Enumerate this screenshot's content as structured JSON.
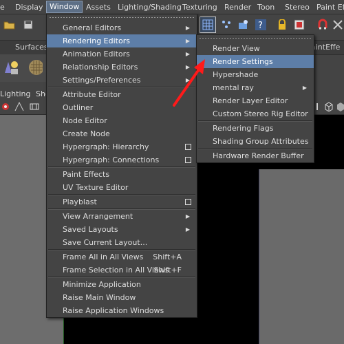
{
  "menubar": {
    "items": [
      "e",
      "Display",
      "Window",
      "Assets",
      "Lighting/Shading",
      "Texturing",
      "Render",
      "Toon",
      "Stereo",
      "Paint Eff"
    ],
    "active_index": 2
  },
  "shelf": {
    "tab_surfaces": "Surfaces",
    "tab_paint_effects": "aintEffe"
  },
  "panel_menu": {
    "lighting": "Lighting",
    "show": "Sho"
  },
  "toolbar_icons": [
    "open-folder-icon",
    "save-icon",
    "render-grid-icon",
    "render-region-icon",
    "ipr-icon",
    "help-icon",
    "lock-icon",
    "render-frame-icon",
    "magnet-icon",
    "snap-icon"
  ],
  "window_menu": {
    "items": [
      {
        "label": "General Editors",
        "type": "submenu"
      },
      {
        "label": "Rendering Editors",
        "type": "submenu",
        "highlighted": true
      },
      {
        "label": "Animation Editors",
        "type": "submenu"
      },
      {
        "label": "Relationship Editors",
        "type": "submenu"
      },
      {
        "label": "Settings/Preferences",
        "type": "submenu"
      },
      {
        "type": "separator"
      },
      {
        "label": "Attribute Editor"
      },
      {
        "label": "Outliner"
      },
      {
        "label": "Node Editor"
      },
      {
        "label": "Create Node"
      },
      {
        "label": "Hypergraph: Hierarchy",
        "type": "option"
      },
      {
        "label": "Hypergraph: Connections",
        "type": "option"
      },
      {
        "type": "separator"
      },
      {
        "label": "Paint Effects"
      },
      {
        "label": "UV Texture Editor"
      },
      {
        "type": "separator"
      },
      {
        "label": "Playblast",
        "type": "option"
      },
      {
        "type": "separator"
      },
      {
        "label": "View Arrangement",
        "type": "submenu"
      },
      {
        "label": "Saved Layouts",
        "type": "submenu"
      },
      {
        "label": "Save Current Layout..."
      },
      {
        "type": "separator"
      },
      {
        "label": "Frame All in All Views",
        "shortcut": "Shift+A"
      },
      {
        "label": "Frame Selection in All Views",
        "shortcut": "Shift+F"
      },
      {
        "type": "separator"
      },
      {
        "label": "Minimize Application"
      },
      {
        "label": "Raise Main Window"
      },
      {
        "label": "Raise Application Windows"
      }
    ]
  },
  "rendering_submenu": {
    "items": [
      {
        "label": "Render View"
      },
      {
        "label": "Render Settings",
        "highlighted": true
      },
      {
        "label": "Hypershade"
      },
      {
        "label": "mental ray",
        "type": "submenu"
      },
      {
        "label": "Render Layer Editor"
      },
      {
        "label": "Custom Stereo Rig Editor"
      },
      {
        "type": "separator"
      },
      {
        "label": "Rendering Flags"
      },
      {
        "label": "Shading Group Attributes"
      },
      {
        "type": "separator"
      },
      {
        "label": "Hardware Render Buffer"
      }
    ]
  },
  "annotation": {
    "color": "#ff1a1a"
  }
}
